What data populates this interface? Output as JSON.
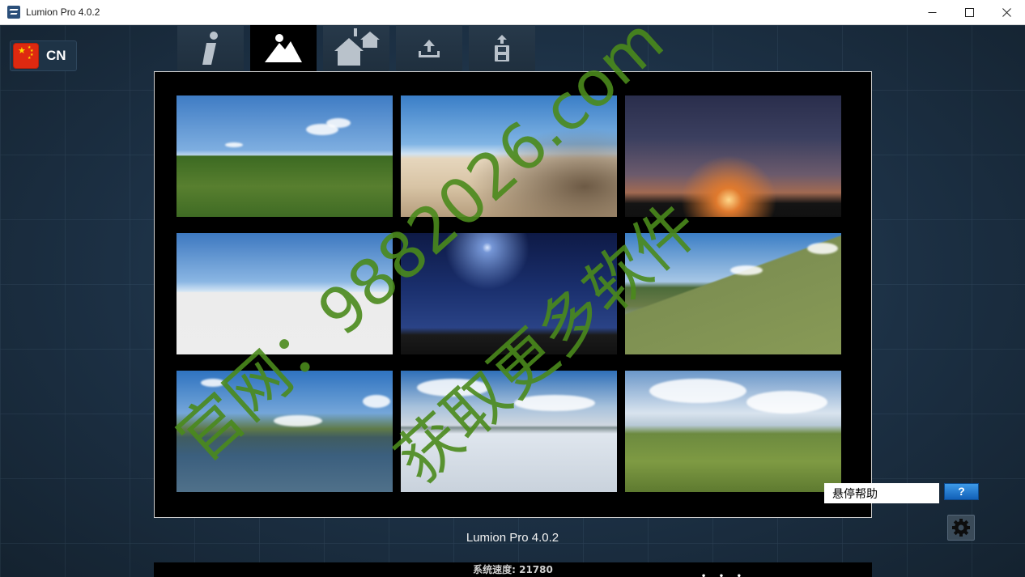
{
  "window": {
    "title": "Lumion Pro 4.0.2"
  },
  "language": {
    "label": "CN"
  },
  "tabs": [
    {
      "name": "info",
      "icon": "info-icon"
    },
    {
      "name": "new-scene",
      "icon": "mountain-icon",
      "active": true
    },
    {
      "name": "examples",
      "icon": "houses-icon"
    },
    {
      "name": "import",
      "icon": "upload-icon"
    },
    {
      "name": "save",
      "icon": "save-icon"
    }
  ],
  "scenes": [
    {
      "id": "grass",
      "style": "sky-grass"
    },
    {
      "id": "desert",
      "style": "desert"
    },
    {
      "id": "sunset",
      "style": "sunset"
    },
    {
      "id": "white",
      "style": "white"
    },
    {
      "id": "night",
      "style": "night"
    },
    {
      "id": "river",
      "style": "river"
    },
    {
      "id": "lake",
      "style": "lake"
    },
    {
      "id": "snow",
      "style": "snow"
    },
    {
      "id": "hills",
      "style": "hills"
    }
  ],
  "watermark": {
    "line1": "官网：9882026.com",
    "line2": "获取更多软件",
    "color": "#4a8a1c"
  },
  "hover_help": {
    "label": "悬停帮助",
    "button": "?"
  },
  "footer": {
    "version": "Lumion Pro 4.0.2",
    "speed": "系统速度: 21780",
    "dots": "• • •"
  },
  "colors": {
    "background": "#1a2c3d",
    "help_button": "#2a7fd4"
  }
}
